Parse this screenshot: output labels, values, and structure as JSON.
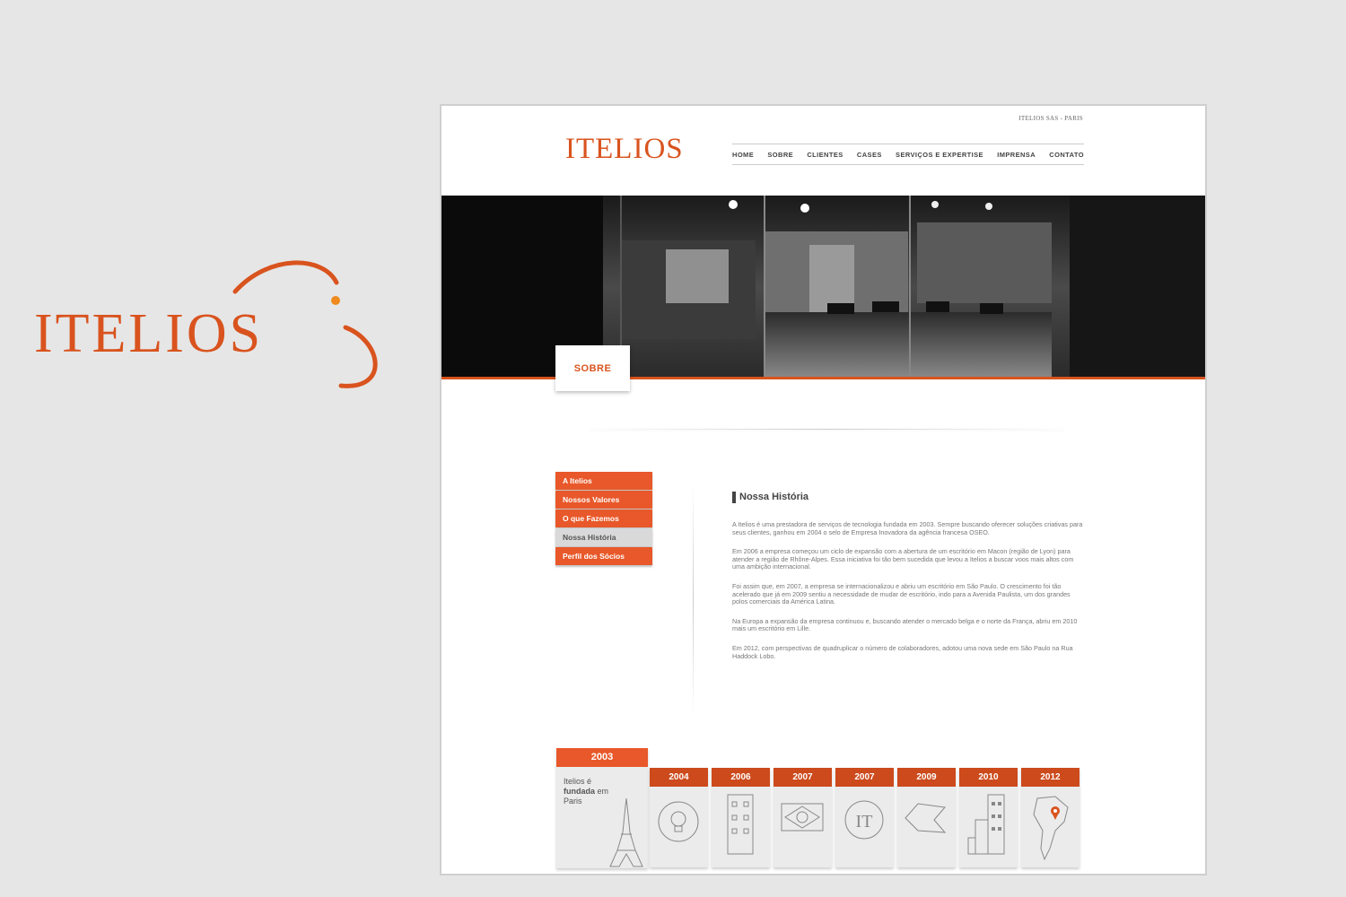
{
  "brand": {
    "logo_text": "ITELIOS",
    "accent": "#d9531e"
  },
  "site": {
    "topline": "ITELIOS SAS - PARIS",
    "logo_text": "ITELIOS",
    "nav": [
      "HOME",
      "SOBRE",
      "CLIENTES",
      "CASES",
      "SERVIÇOS E EXPERTISE",
      "IMPRENSA",
      "CONTATO"
    ],
    "section_tab": "SOBRE"
  },
  "side_menu": {
    "items": [
      "A Itelios",
      "Nossos Valores",
      "O que Fazemos",
      "Nossa História",
      "Perfil dos Sócios"
    ],
    "active": "Nossa História"
  },
  "content": {
    "title": "Nossa História",
    "paragraphs": [
      "A Itelios é uma prestadora de serviços de tecnologia fundada em 2003. Sempre buscando oferecer soluções criativas para seus clientes, ganhou em 2004 o selo de Empresa Inovadora da agência francesa OSEO.",
      "Em 2006 a empresa começou um ciclo de expansão com a abertura de um escritório em Macon (região de Lyon) para atender a região de Rhône-Alpes. Essa iniciativa foi tão bem sucedida que levou a Itelios a buscar voos mais altos com uma ambição internacional.",
      "Foi assim que, em 2007, a empresa se internacionalizou e abriu um escritório em São Paulo. O crescimento foi tão acelerado que já em 2009 sentiu a necessidade de mudar de escritório, indo para a Avenida Paulista, um dos grandes polos comerciais da América Latina.",
      "Na Europa a expansão da empresa continuou e, buscando atender o mercado belga e o norte da França, abriu em 2010 mais um escritório em Lille.",
      "Em 2012, com perspectivas de quadruplicar o número de colaboradores, adotou uma nova sede em São Paulo na Rua Haddock Lobo."
    ]
  },
  "timeline": {
    "first": {
      "year": "2003",
      "text_pre": "Itelios é",
      "text_bold": "fundada",
      "text_post": "em Paris",
      "icon": "eiffel-tower-icon"
    },
    "cards": [
      {
        "year": "2004",
        "icon": "lightbulb-icon"
      },
      {
        "year": "2006",
        "icon": "building-icon"
      },
      {
        "year": "2007",
        "icon": "brazil-flag-icon"
      },
      {
        "year": "2007",
        "icon": "it-logo-icon"
      },
      {
        "year": "2009",
        "icon": "map-shape-icon"
      },
      {
        "year": "2010",
        "icon": "city-icon"
      },
      {
        "year": "2012",
        "icon": "south-america-pin-icon"
      }
    ]
  }
}
